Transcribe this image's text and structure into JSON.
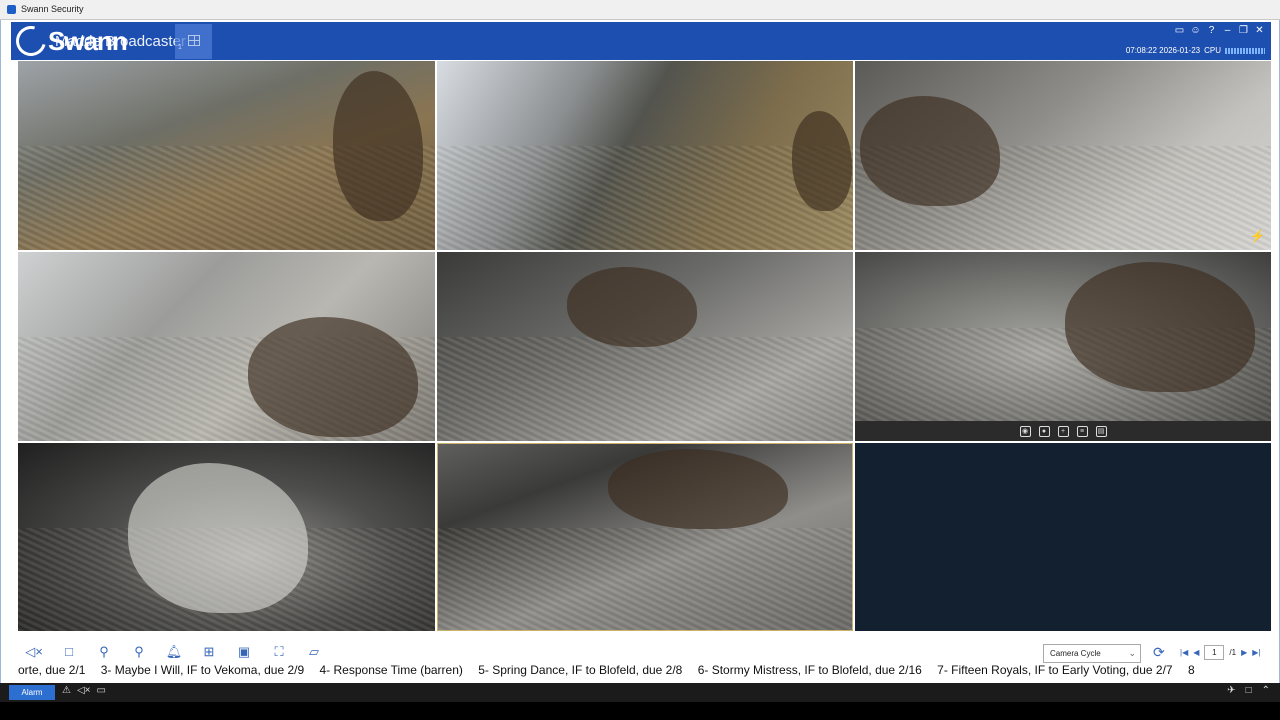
{
  "window": {
    "title": "Swann Security"
  },
  "header": {
    "brand": "Swann",
    "tab_label": "Madde Broadcaster",
    "tab_number": "1",
    "datetime": "07:08:22 2026-01-23",
    "cpu_label": "CPU",
    "icons": [
      "monitor-icon",
      "user-icon",
      "help-icon",
      "minimize-icon",
      "restore-icon",
      "close-icon"
    ]
  },
  "cameras": [
    {
      "id": "cam-1"
    },
    {
      "id": "cam-2"
    },
    {
      "id": "cam-3"
    },
    {
      "id": "cam-4"
    },
    {
      "id": "cam-5"
    },
    {
      "id": "cam-6"
    },
    {
      "id": "cam-7"
    },
    {
      "id": "cam-8"
    },
    {
      "id": "cam-9-empty"
    }
  ],
  "camera_toolbar": [
    "snapshot-icon",
    "record-icon",
    "zoom-icon",
    "stream-icon",
    "print-icon"
  ],
  "bottom_toolbar": {
    "tools": [
      "audio-mute-icon",
      "stop-icon",
      "pin-icon",
      "pin-outline-icon",
      "bell-icon",
      "layout-icon",
      "save-layout-icon",
      "fullscreen-icon",
      "aspect-icon"
    ],
    "camera_cycle": "Camera Cycle",
    "page_current": "1",
    "page_total": "/1"
  },
  "ticker": [
    "orte, due 2/1",
    "3- Maybe I Will, IF to Vekoma, due 2/9",
    "4- Response Time (barren)",
    "5- Spring Dance, IF to Blofeld, due 2/8",
    "6- Stormy Mistress, IF to Blofeld, due 2/16",
    "7- Fifteen Royals, IF to Early Voting, due 2/7",
    "8"
  ],
  "taskbar": {
    "alarm_label": "Alarm"
  },
  "colors": {
    "brand_blue": "#1d4fb0",
    "empty_cell": "#122030",
    "selected_border": "#c9b26a"
  }
}
